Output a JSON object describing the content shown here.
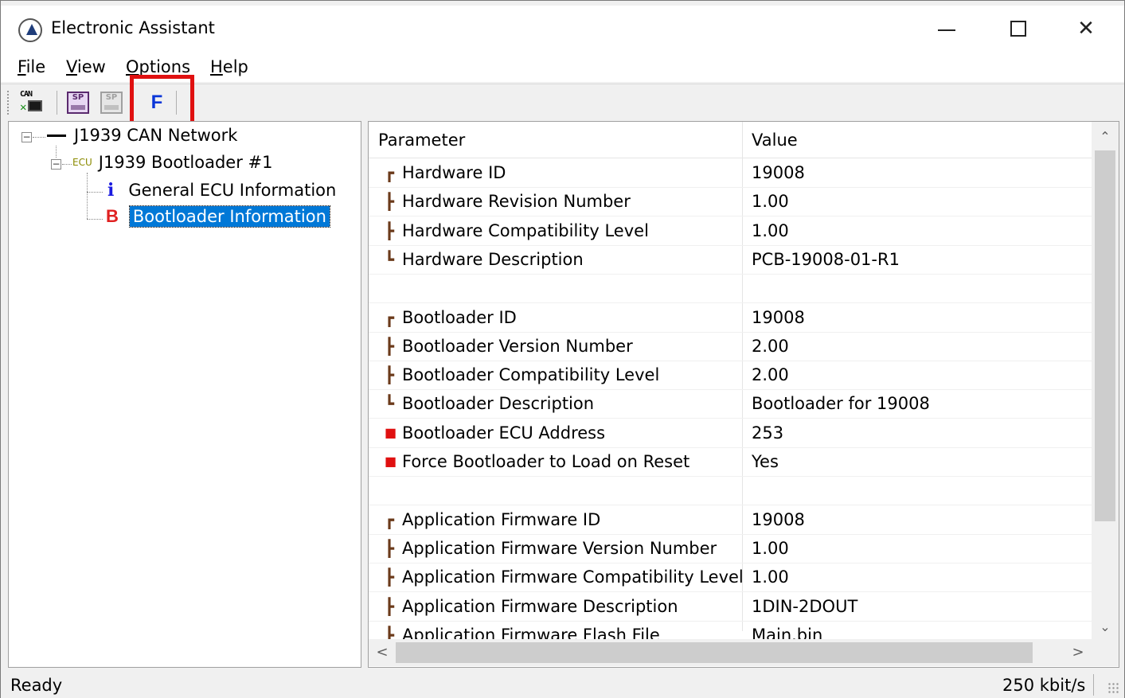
{
  "window": {
    "title": "Electronic Assistant",
    "minimize": "minimize",
    "maximize": "maximize",
    "close": "✕"
  },
  "menu": {
    "file_first": "F",
    "file_rest": "ile",
    "view_first": "V",
    "view_rest": "iew",
    "options_first": "O",
    "options_rest": "ptions",
    "help_first": "H",
    "help_rest": "elp"
  },
  "toolbar": {
    "can_label": "CAN",
    "can_x": "✕",
    "sp_label": "SP",
    "sp_disabled_label": "SP",
    "f_label": "F",
    "highlight_color": "#e01010"
  },
  "tree": {
    "network": "J1939 CAN Network",
    "ecu_tag": "ECU",
    "ecu": "J1939 Bootloader #1",
    "general_icon": "i",
    "general": "General ECU Information",
    "boot_icon": "B",
    "boot": "Bootloader Information",
    "expander": "−"
  },
  "table": {
    "headers": [
      "Parameter",
      "Value"
    ],
    "rows": [
      {
        "param": "Hardware ID",
        "value": "19008",
        "glyph": "┏"
      },
      {
        "param": "Hardware Revision Number",
        "value": "1.00",
        "glyph": "┣"
      },
      {
        "param": "Hardware Compatibility Level",
        "value": "1.00",
        "glyph": "┣"
      },
      {
        "param": "Hardware Description",
        "value": "PCB-19008-01-R1",
        "glyph": "┗"
      },
      {
        "param": "",
        "value": "",
        "glyph": ""
      },
      {
        "param": "Bootloader ID",
        "value": "19008",
        "glyph": "┏"
      },
      {
        "param": "Bootloader Version Number",
        "value": "2.00",
        "glyph": "┣"
      },
      {
        "param": "Bootloader Compatibility Level",
        "value": "2.00",
        "glyph": "┣"
      },
      {
        "param": "Bootloader Description",
        "value": "Bootloader for 19008",
        "glyph": "┗"
      },
      {
        "param": "Bootloader ECU Address",
        "value": "253",
        "glyph": "■"
      },
      {
        "param": "Force Bootloader to Load on Reset",
        "value": "Yes",
        "glyph": "■"
      },
      {
        "param": "",
        "value": "",
        "glyph": ""
      },
      {
        "param": "Application Firmware ID",
        "value": "19008",
        "glyph": "┏"
      },
      {
        "param": "Application Firmware Version Number",
        "value": "1.00",
        "glyph": "┣"
      },
      {
        "param": "Application Firmware Compatibility Level",
        "value": "1.00",
        "glyph": "┣"
      },
      {
        "param": "Application Firmware Description",
        "value": "1DIN-2DOUT",
        "glyph": "┣"
      },
      {
        "param": "Application Firmware Flash File",
        "value": "Main.bin",
        "glyph": "┣"
      }
    ]
  },
  "scroll": {
    "up": "⌃",
    "down": "⌄",
    "left": "<",
    "right": ">"
  },
  "status": {
    "left": "Ready",
    "right": "250 kbit/s"
  }
}
